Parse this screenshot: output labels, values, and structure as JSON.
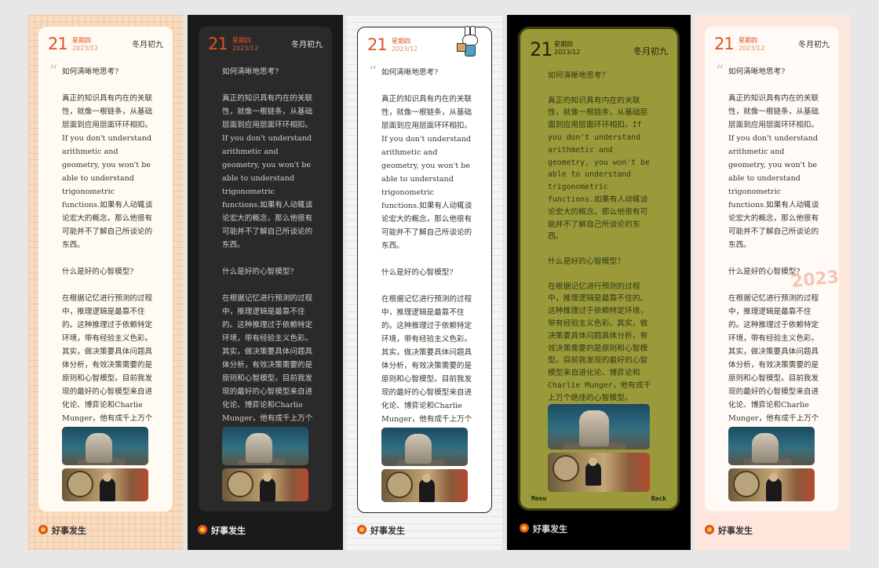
{
  "app": {
    "brand": "好事发生"
  },
  "date": {
    "day": "21",
    "weekday": "星期四",
    "year_month": "2023/12",
    "lunar": "冬月初九"
  },
  "quote_mark": "“",
  "content": {
    "text": "如何清晰地思考?\n\n真正的知识具有内在的关联性，就像一根链条，从基础层面到应用层面环环相扣。If you don't understand arithmetic and geometry, you won't be able to understand trigonometric functions.如果有人动辄谈论宏大的概念，那么他很有可能并不了解自己所谈论的东西。\n\n什么是好的心智模型?\n\n在根据记忆进行预测的过程中，推理逻辑是最靠不住的。这种推理过于依赖特定环境，带有经验主义色彩。其实，做决策要具体问题具体分析，有效决策需要的是原则和心智模型。目前我发现的最好的心智模型来自进化论、博弈论和Charlie Munger，他有成千上万个绝佳的心智模型。",
    "text_lcd": "如何清晰地思考？\n\n真正的知识具有内在的关联性，就像一根链条，从基础层面到应用层面环环相扣。If you don't understand arithmetic and geometry, you won't be able to understand trigonometric functions.如果有人动辄谈论宏大的概念，那么他很有可能并不了解自己所谈论的东西。\n\n什么是好的心智模型？\n\n在根据记忆进行预测的过程中，推理逻辑是最靠不住的。这种推理过于依赖特定环境，带有经验主义色彩。其实，做决策要具体问题具体分析，有效决策需要的是原则和心智模型。目前我发现的最好的心智模型来自进化论、博弈论和Charlie Munger，他有成千上万个绝佳的心智模型。"
  },
  "lcd_menu": {
    "left": "Menu",
    "right": "Back"
  },
  "stamp": "2023",
  "themes": {
    "grid": "#f7dcc0",
    "dark": "#222222",
    "white": "#ffffff",
    "lcd": "#9a9a3a",
    "peach": "#fde6dc",
    "accent": "#e0531f"
  }
}
